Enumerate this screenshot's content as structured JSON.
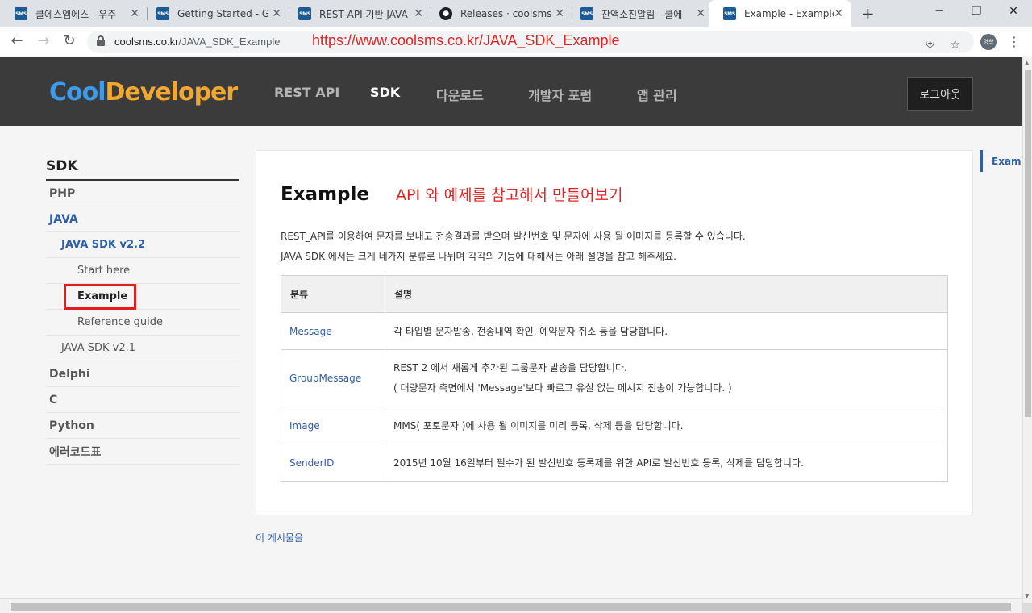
{
  "browser": {
    "tabs": [
      {
        "title": "쿨에스엠에스 - 우주",
        "icon": "sms-favicon"
      },
      {
        "title": "Getting Started - Ge",
        "icon": "sms-favicon"
      },
      {
        "title": "REST API 기반 JAVA",
        "icon": "sms-favicon"
      },
      {
        "title": "Releases · coolsms/j",
        "icon": "github-favicon"
      },
      {
        "title": "잔액소진알림 - 쿨에",
        "icon": "sms-favicon"
      },
      {
        "title": "Example - Example",
        "icon": "sms-favicon",
        "active": true
      }
    ],
    "favicon_text": "SMS",
    "url_host": "coolsms.co.kr",
    "url_path": "/JAVA_SDK_Example",
    "url_annotation": "https://www.coolsms.co.kr/JAVA_SDK_Example",
    "profile_label": "영학"
  },
  "header": {
    "logo_part1": "Cool",
    "logo_part2": "Developer",
    "nav": [
      "REST API",
      "SDK",
      "다운로드",
      "개발자 포럼",
      "앱 관리"
    ],
    "active_nav": "SDK",
    "logout_label": "로그아웃"
  },
  "sidebar": {
    "title": "SDK",
    "items": [
      {
        "label": "PHP",
        "level": 1
      },
      {
        "label": "JAVA",
        "level": 1,
        "active": true
      },
      {
        "label": "JAVA SDK v2.2",
        "level": 2,
        "active": true
      },
      {
        "label": "Start here",
        "level": 3
      },
      {
        "label": "Example",
        "level": 3,
        "active": true
      },
      {
        "label": "Reference guide",
        "level": 3
      },
      {
        "label": "JAVA SDK v2.1",
        "level": 2
      },
      {
        "label": "Delphi",
        "level": 1
      },
      {
        "label": "C",
        "level": 1
      },
      {
        "label": "Python",
        "level": 1
      },
      {
        "label": "에러코드표",
        "level": 1
      }
    ]
  },
  "content": {
    "title": "Example",
    "annotation": "API 와 예제를 참고해서 만들어보기",
    "intro_line1": "REST_API를 이용하여 문자를 보내고 전송결과를 받으며 발신번호 및 문자에 사용 될 이미지를 등록할 수 있습니다.",
    "intro_line2": "JAVA SDK 에서는 크게 네가지 분류로 나뉘며 각각의 기능에 대해서는 아래 설명을 참고 해주세요.",
    "table": {
      "headers": [
        "분류",
        "설명"
      ],
      "rows": [
        {
          "name": "Message",
          "desc": [
            "각 타입별 문자발송, 전송내역 확인, 예약문자 취소 등을 담당합니다."
          ]
        },
        {
          "name": "GroupMessage",
          "desc": [
            "REST 2 에서 새롭게 추가된 그룹문자 발송을 담당합니다.",
            "( 대량문자 측면에서 'Message'보다 빠르고 유실 없는 메시지 전송이 가능합니다. )"
          ]
        },
        {
          "name": "Image",
          "desc": [
            "MMS( 포토문자 )에 사용 될 이미지를 미리 등록, 삭제 등을 담당합니다."
          ]
        },
        {
          "name": "SenderID",
          "desc": [
            "2015년 10월 16일부터 필수가 된 발신번호 등록제를 위한 API로 발신번호 등록, 삭제를 담당합니다."
          ]
        }
      ]
    },
    "more_link": "이 게시물을"
  },
  "toc": {
    "item": "Example"
  }
}
